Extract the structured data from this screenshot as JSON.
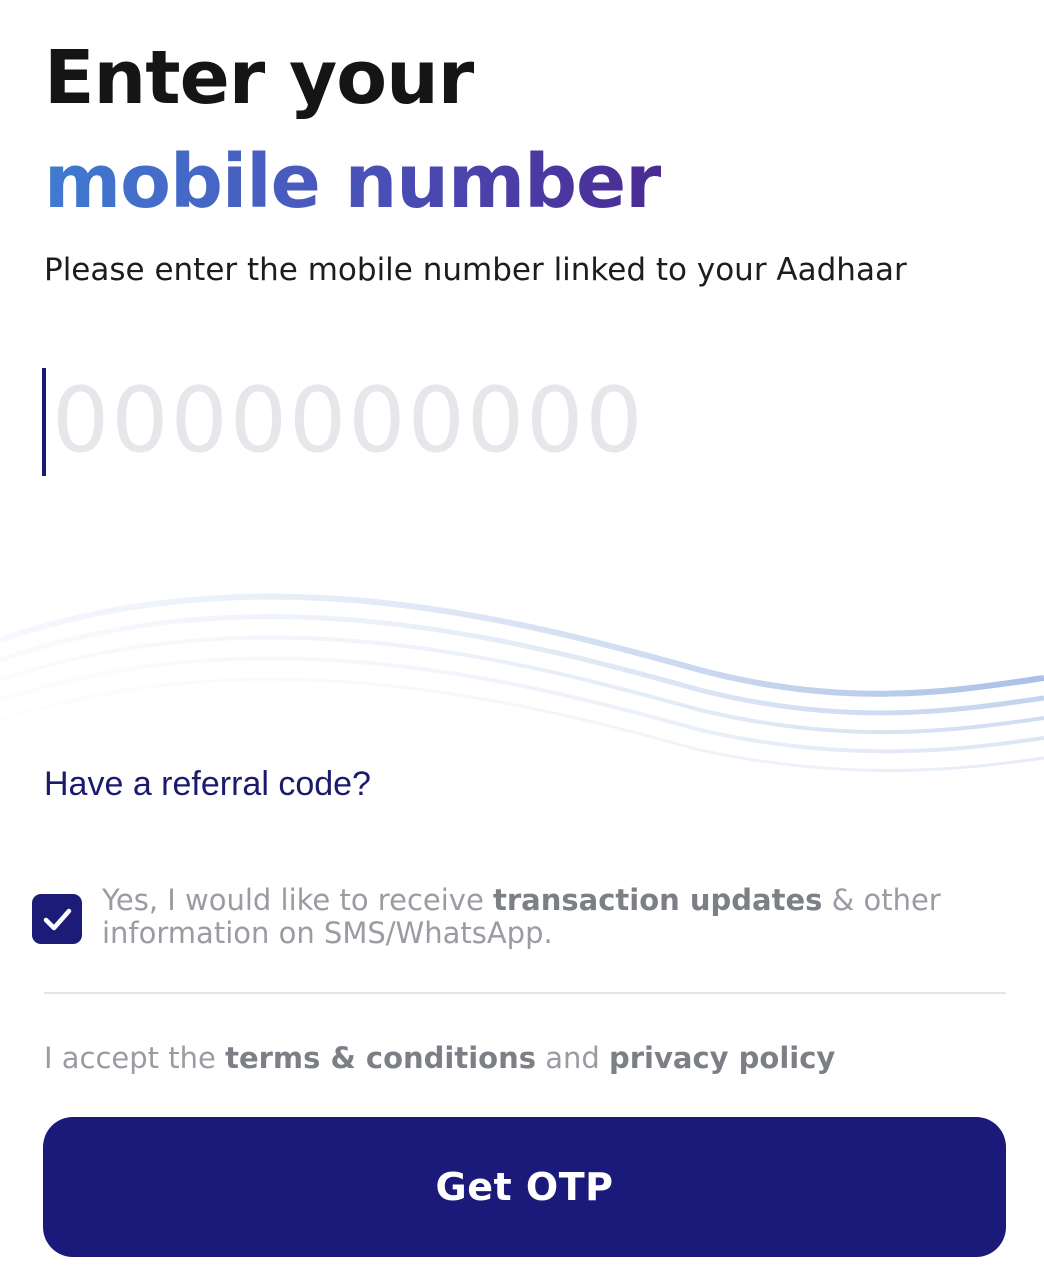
{
  "header": {
    "title_line1": "Enter your",
    "title_line2": "mobile number",
    "subtitle": "Please enter the mobile number linked to your Aadhaar"
  },
  "mobile_input": {
    "value": "",
    "placeholder": "0000000000"
  },
  "referral": {
    "label": "Have a referral code?"
  },
  "consent": {
    "checked": true,
    "text_before": "Yes, I would like to receive ",
    "text_bold": "transaction updates",
    "text_after": " & other information on SMS/WhatsApp."
  },
  "terms": {
    "prefix": "I accept the ",
    "terms_link": "terms & conditions",
    "middle": " and ",
    "privacy_link": "privacy policy"
  },
  "cta": {
    "label": "Get OTP"
  },
  "colors": {
    "primary": "#1b1a7a",
    "title_gradient_start": "#3f7bd0",
    "title_gradient_end": "#4a2a93",
    "muted_text": "#9a9ca2"
  },
  "icons": {
    "checkbox": "checkmark-icon"
  }
}
